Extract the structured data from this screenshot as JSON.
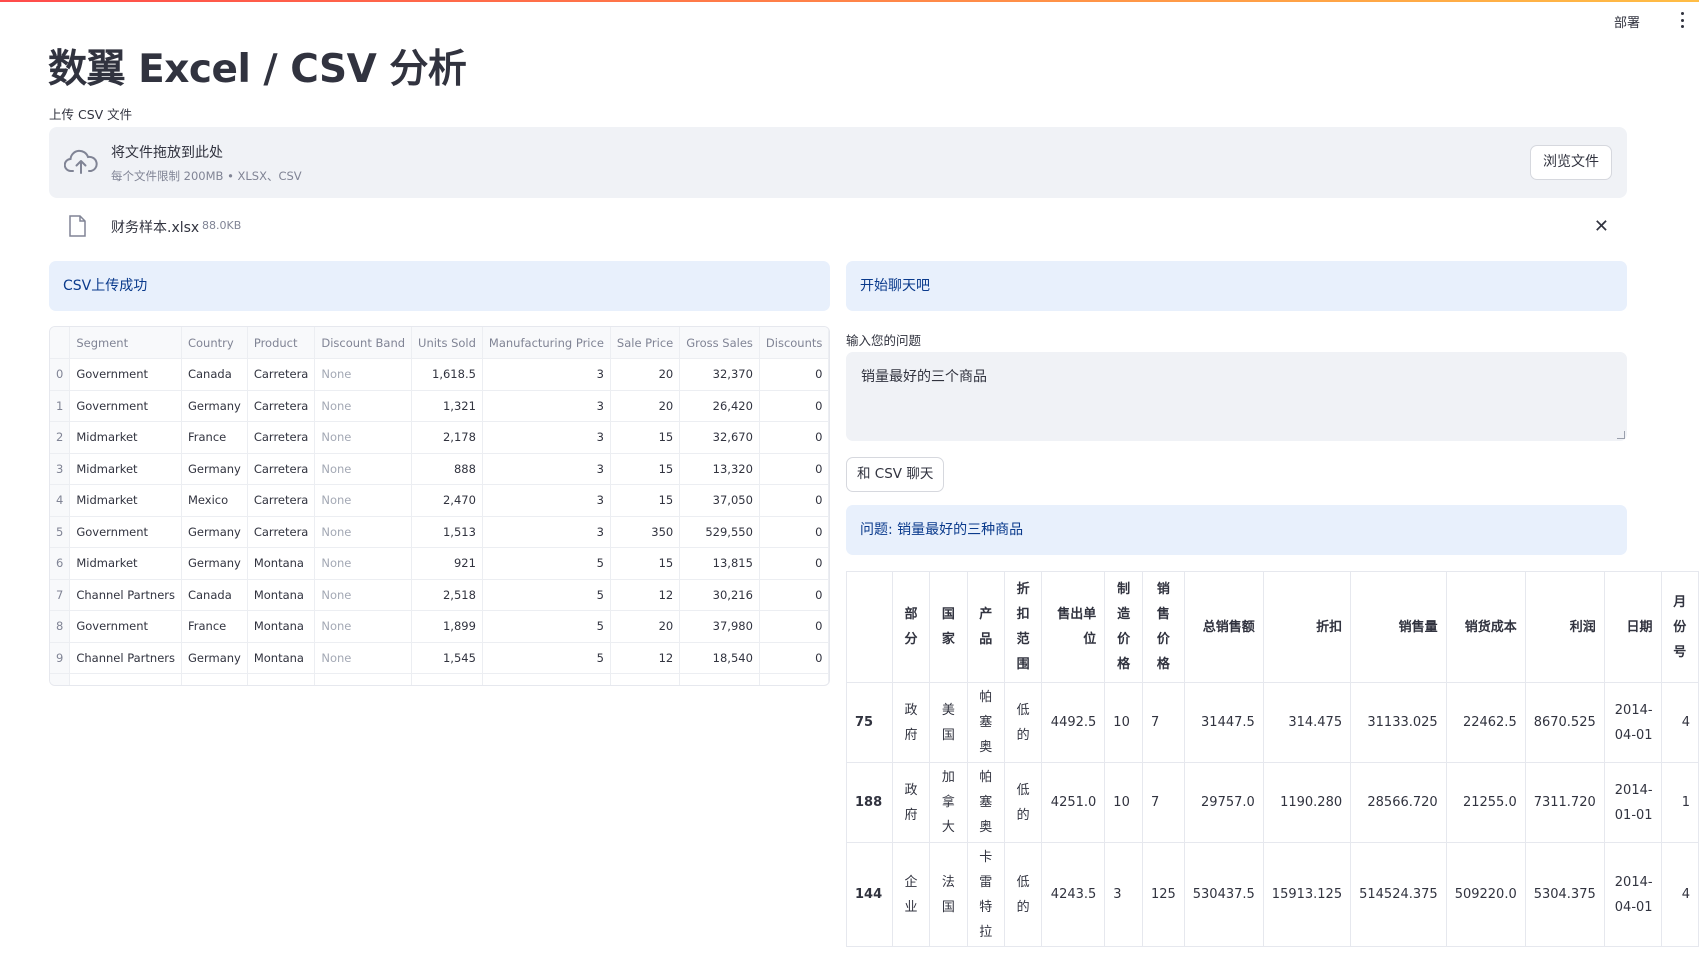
{
  "header": {
    "deploy_label": "部署"
  },
  "title": "数翼 Excel / CSV 分析",
  "uploader": {
    "label": "上传 CSV 文件",
    "drop_text": "将文件拖放到此处",
    "limit_text": "每个文件限制 200MB • XLSX、CSV",
    "browse_label": "浏览文件",
    "file_name": "财务样本.xlsx",
    "file_size": "88.0KB"
  },
  "left_alert": "CSV上传成功",
  "right_alert": "开始聊天吧",
  "dataframe": {
    "columns": [
      "Segment",
      "Country",
      "Product",
      "Discount Band",
      "Units Sold",
      "Manufacturing Price",
      "Sale Price",
      "Gross Sales",
      "Discounts"
    ],
    "rows": [
      [
        "0",
        "Government",
        "Canada",
        "Carretera",
        "None",
        "1,618.5",
        "3",
        "20",
        "32,370",
        "0"
      ],
      [
        "1",
        "Government",
        "Germany",
        "Carretera",
        "None",
        "1,321",
        "3",
        "20",
        "26,420",
        "0"
      ],
      [
        "2",
        "Midmarket",
        "France",
        "Carretera",
        "None",
        "2,178",
        "3",
        "15",
        "32,670",
        "0"
      ],
      [
        "3",
        "Midmarket",
        "Germany",
        "Carretera",
        "None",
        "888",
        "3",
        "15",
        "13,320",
        "0"
      ],
      [
        "4",
        "Midmarket",
        "Mexico",
        "Carretera",
        "None",
        "2,470",
        "3",
        "15",
        "37,050",
        "0"
      ],
      [
        "5",
        "Government",
        "Germany",
        "Carretera",
        "None",
        "1,513",
        "3",
        "350",
        "529,550",
        "0"
      ],
      [
        "6",
        "Midmarket",
        "Germany",
        "Montana",
        "None",
        "921",
        "5",
        "15",
        "13,815",
        "0"
      ],
      [
        "7",
        "Channel Partners",
        "Canada",
        "Montana",
        "None",
        "2,518",
        "5",
        "12",
        "30,216",
        "0"
      ],
      [
        "8",
        "Government",
        "France",
        "Montana",
        "None",
        "1,899",
        "5",
        "20",
        "37,980",
        "0"
      ],
      [
        "9",
        "Channel Partners",
        "Germany",
        "Montana",
        "None",
        "1,545",
        "5",
        "12",
        "18,540",
        "0"
      ]
    ]
  },
  "chat": {
    "question_label": "输入您的问题",
    "question_value": "销量最好的三个商品",
    "submit_label": "和 CSV 聊天",
    "answer_title": "问题: 销量最好的三种商品"
  },
  "result": {
    "columns": [
      "部分",
      "国家",
      "产品",
      "折扣范围",
      "售出单位",
      "制造价格",
      "销售价格",
      "总销售额",
      "折扣",
      "销售量",
      "销货成本",
      "利润",
      "日期",
      "月份号"
    ],
    "rows": [
      [
        "75",
        "政府",
        "美国",
        "帕塞奥",
        "低的",
        "4492.5",
        "10",
        "7",
        "31447.5",
        "314.475",
        "31133.025",
        "22462.5",
        "8670.525",
        "2014-04-01",
        "4"
      ],
      [
        "188",
        "政府",
        "加拿大",
        "帕塞奥",
        "低的",
        "4251.0",
        "10",
        "7",
        "29757.0",
        "1190.280",
        "28566.720",
        "21255.0",
        "7311.720",
        "2014-01-01",
        "1"
      ],
      [
        "144",
        "企业",
        "法国",
        "卡雷特拉",
        "低的",
        "4243.5",
        "3",
        "125",
        "530437.5",
        "15913.125",
        "514524.375",
        "509220.0",
        "5304.375",
        "2014-04-01",
        "4"
      ]
    ]
  }
}
